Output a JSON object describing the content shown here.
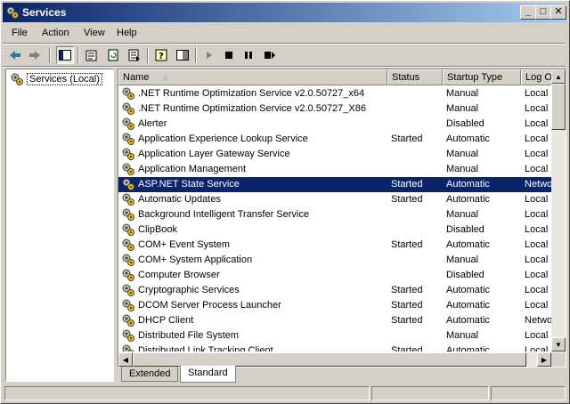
{
  "window": {
    "title": "Services",
    "accent": "#0a246a"
  },
  "menu": [
    "File",
    "Action",
    "View",
    "Help"
  ],
  "toolbar_icons": [
    "back-arrow-icon",
    "forward-arrow-icon",
    "show-hide-tree-icon",
    "properties-icon",
    "refresh-icon",
    "export-list-icon",
    "help-icon",
    "console-icon",
    "start-service-icon",
    "stop-service-icon",
    "pause-service-icon",
    "restart-service-icon"
  ],
  "tree": {
    "root_label": "Services (Local)"
  },
  "columns": [
    "Name",
    "Status",
    "Startup Type",
    "Log O"
  ],
  "rows": [
    {
      "name": ".NET Runtime Optimization Service v2.0.50727_x64",
      "status": "",
      "startup": "Manual",
      "logon": "Local S"
    },
    {
      "name": ".NET Runtime Optimization Service v2.0.50727_X86",
      "status": "",
      "startup": "Manual",
      "logon": "Local S"
    },
    {
      "name": "Alerter",
      "status": "",
      "startup": "Disabled",
      "logon": "Local S"
    },
    {
      "name": "Application Experience Lookup Service",
      "status": "Started",
      "startup": "Automatic",
      "logon": "Local S"
    },
    {
      "name": "Application Layer Gateway Service",
      "status": "",
      "startup": "Manual",
      "logon": "Local S"
    },
    {
      "name": "Application Management",
      "status": "",
      "startup": "Manual",
      "logon": "Local S"
    },
    {
      "name": "ASP.NET State Service",
      "status": "Started",
      "startup": "Automatic",
      "logon": "Netwo",
      "selected": true
    },
    {
      "name": "Automatic Updates",
      "status": "Started",
      "startup": "Automatic",
      "logon": "Local S"
    },
    {
      "name": "Background Intelligent Transfer Service",
      "status": "",
      "startup": "Manual",
      "logon": "Local S"
    },
    {
      "name": "ClipBook",
      "status": "",
      "startup": "Disabled",
      "logon": "Local S"
    },
    {
      "name": "COM+ Event System",
      "status": "Started",
      "startup": "Automatic",
      "logon": "Local S"
    },
    {
      "name": "COM+ System Application",
      "status": "",
      "startup": "Manual",
      "logon": "Local S"
    },
    {
      "name": "Computer Browser",
      "status": "",
      "startup": "Disabled",
      "logon": "Local S"
    },
    {
      "name": "Cryptographic Services",
      "status": "Started",
      "startup": "Automatic",
      "logon": "Local S"
    },
    {
      "name": "DCOM Server Process Launcher",
      "status": "Started",
      "startup": "Automatic",
      "logon": "Local S"
    },
    {
      "name": "DHCP Client",
      "status": "Started",
      "startup": "Automatic",
      "logon": "Netwo"
    },
    {
      "name": "Distributed File System",
      "status": "",
      "startup": "Manual",
      "logon": "Local S"
    },
    {
      "name": "Distributed Link Tracking Client",
      "status": "Started",
      "startup": "Automatic",
      "logon": "Local S"
    }
  ],
  "tabs": [
    "Extended",
    "Standard"
  ],
  "active_tab": "Standard"
}
